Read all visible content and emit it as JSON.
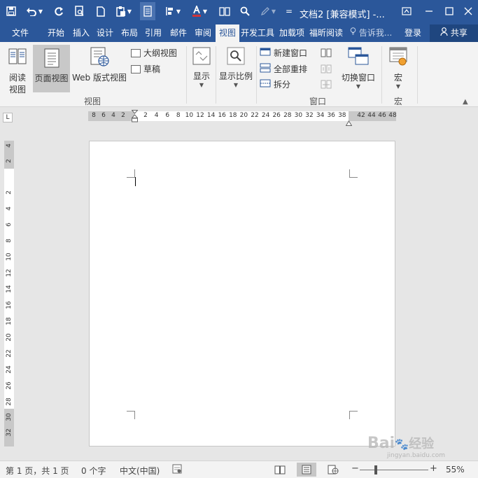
{
  "window": {
    "title": "文档2 [兼容模式] -...",
    "qat_more": "="
  },
  "ribbon_tabs": [
    {
      "label": "文件"
    },
    {
      "label": "开始"
    },
    {
      "label": "插入"
    },
    {
      "label": "设计"
    },
    {
      "label": "布局"
    },
    {
      "label": "引用"
    },
    {
      "label": "邮件"
    },
    {
      "label": "审阅"
    },
    {
      "label": "视图"
    },
    {
      "label": "开发工具"
    },
    {
      "label": "加载项"
    },
    {
      "label": "福昕阅读"
    }
  ],
  "active_tab": "视图",
  "tell_me": "告诉我...",
  "login": "登录",
  "share": "共享",
  "ribbon": {
    "views_group": {
      "read_mode": "阅读视图",
      "read_mode_line1": "阅读",
      "read_mode_line2": "视图",
      "print_layout": "页面视图",
      "web_layout": "Web 版式视图",
      "outline": "大纲视图",
      "draft": "草稿",
      "label": "视图"
    },
    "show_group": {
      "show": "显示"
    },
    "zoom_group": {
      "zoom": "显示比例"
    },
    "window_group": {
      "new_window": "新建窗口",
      "arrange_all": "全部重排",
      "split": "拆分",
      "switch_windows": "切换窗口",
      "label": "窗口"
    },
    "macros_group": {
      "macros": "宏",
      "label": "宏"
    }
  },
  "ruler": {
    "horizontal_left": [
      "8",
      "6",
      "4",
      "2"
    ],
    "horizontal": [
      "2",
      "4",
      "6",
      "8",
      "10",
      "12",
      "14",
      "16",
      "18",
      "20",
      "22",
      "24",
      "26",
      "28",
      "30",
      "32",
      "34",
      "36",
      "38"
    ],
    "horizontal_right": [
      "42",
      "44",
      "46",
      "48"
    ],
    "vertical_top": [
      "4",
      "2"
    ],
    "vertical": [
      "2",
      "4",
      "6",
      "8",
      "10",
      "12",
      "14",
      "16",
      "18",
      "20",
      "22",
      "24",
      "26",
      "28"
    ],
    "vertical_bottom": [
      "30",
      "32"
    ]
  },
  "status": {
    "page": "第 1 页，共 1 页",
    "words": "0 个字",
    "language": "中文(中国)",
    "zoom_minus": "−",
    "zoom_plus": "+",
    "zoom": "55%",
    "zoom_fraction": 0.55
  },
  "watermark": {
    "brand": "Bai",
    "brand2": "经验",
    "url": "jingyan.baidu.com"
  },
  "colors": {
    "title_bar": "#2b579a",
    "ribbon_bg": "#f3f3f3",
    "workspace": "#e6e6e6",
    "font_color_underline": "#d13438"
  }
}
